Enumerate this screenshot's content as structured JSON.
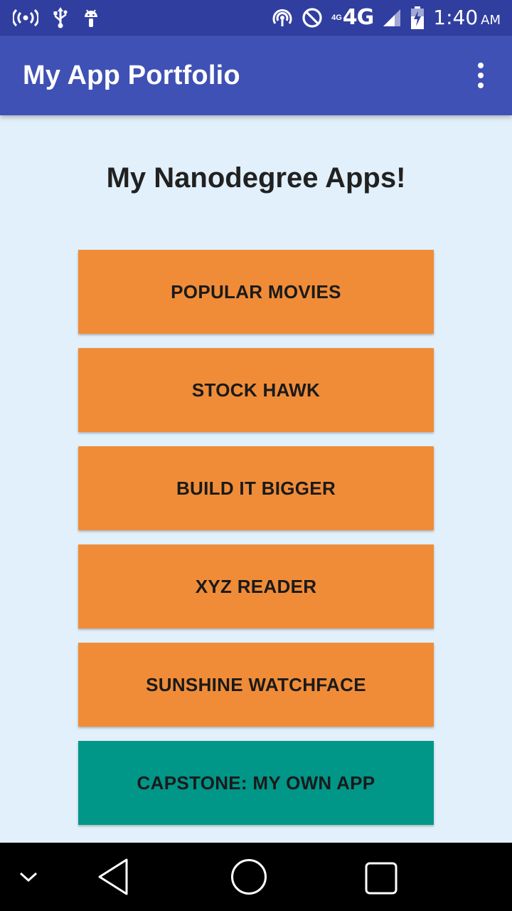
{
  "status_bar": {
    "network_small": "4G",
    "network": "4G",
    "time": "1:40",
    "ampm": "AM",
    "icons": [
      "hotspot-icon",
      "usb-icon",
      "android-debug-icon",
      "nfc-icon",
      "do-not-disturb-icon",
      "signal-icon",
      "battery-charging-icon"
    ]
  },
  "app_bar": {
    "title": "My App Portfolio",
    "menu_icon": "more-vert-icon"
  },
  "main": {
    "heading": "My Nanodegree Apps!",
    "buttons": [
      {
        "label": "POPULAR MOVIES",
        "color": "#f08c38"
      },
      {
        "label": "STOCK HAWK",
        "color": "#f08c38"
      },
      {
        "label": "BUILD IT BIGGER",
        "color": "#f08c38"
      },
      {
        "label": "XYZ READER",
        "color": "#f08c38"
      },
      {
        "label": "SUNSHINE WATCHFACE",
        "color": "#f08c38"
      },
      {
        "label": "CAPSTONE: MY OWN APP",
        "color": "#009688"
      }
    ]
  },
  "nav_bar": {
    "icons": [
      "collapse-down-icon",
      "back-icon",
      "home-icon",
      "recents-icon"
    ]
  },
  "colors": {
    "status_bar": "#303f9f",
    "app_bar": "#3f51b5",
    "background": "#e1f0fb",
    "accent_orange": "#f08c38",
    "accent_teal": "#009688"
  }
}
